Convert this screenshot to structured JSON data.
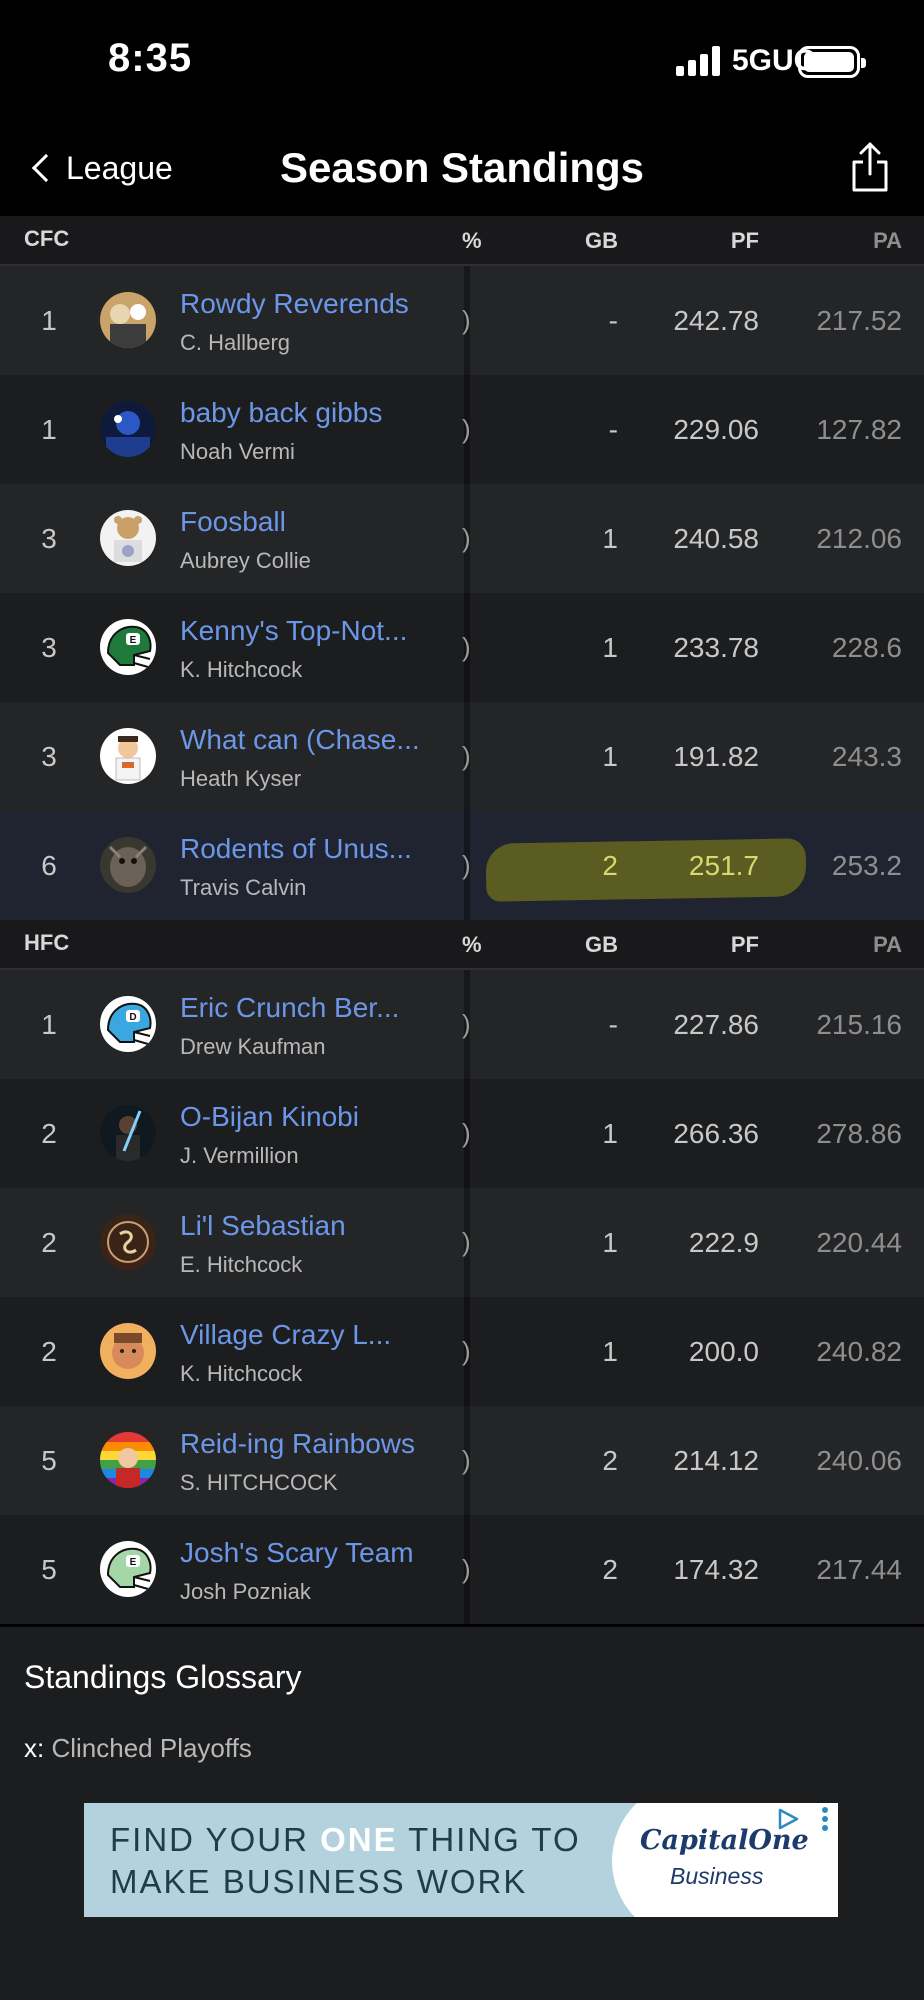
{
  "status_bar": {
    "time": "8:35",
    "network": "5GUC"
  },
  "nav": {
    "back_label": "League",
    "title": "Season Standings"
  },
  "columns": {
    "pct": "%",
    "gb": "GB",
    "pf": "PF",
    "pa": "PA"
  },
  "conferences": [
    {
      "name": "CFC",
      "teams": [
        {
          "rank": "1",
          "name": "Rowdy Reverends",
          "owner": "C. Hallberg",
          "pct": ")",
          "gb": "-",
          "pf": "242.78",
          "pa": "217.52"
        },
        {
          "rank": "1",
          "name": "baby back gibbs",
          "owner": "Noah Vermi",
          "pct": ")",
          "gb": "-",
          "pf": "229.06",
          "pa": "127.82"
        },
        {
          "rank": "3",
          "name": "Foosball",
          "owner": "Aubrey Collie",
          "pct": ")",
          "gb": "1",
          "pf": "240.58",
          "pa": "212.06"
        },
        {
          "rank": "3",
          "name": "Kenny's Top-Not...",
          "owner": "K. Hitchcock",
          "pct": ")",
          "gb": "1",
          "pf": "233.78",
          "pa": "228.6"
        },
        {
          "rank": "3",
          "name": "What can (Chase...",
          "owner": "Heath Kyser",
          "pct": ")",
          "gb": "1",
          "pf": "191.82",
          "pa": "243.3"
        },
        {
          "rank": "6",
          "name": "Rodents of Unus...",
          "owner": "Travis Calvin",
          "pct": ")",
          "gb": "2",
          "pf": "251.7",
          "pa": "253.2"
        }
      ]
    },
    {
      "name": "HFC",
      "teams": [
        {
          "rank": "1",
          "name": "Eric Crunch Ber...",
          "owner": "Drew Kaufman",
          "pct": ")",
          "gb": "-",
          "pf": "227.86",
          "pa": "215.16"
        },
        {
          "rank": "2",
          "name": "O-Bijan Kinobi",
          "owner": "J. Vermillion",
          "pct": ")",
          "gb": "1",
          "pf": "266.36",
          "pa": "278.86"
        },
        {
          "rank": "2",
          "name": "Li'l Sebastian",
          "owner": "E. Hitchcock",
          "pct": ")",
          "gb": "1",
          "pf": "222.9",
          "pa": "220.44"
        },
        {
          "rank": "2",
          "name": "Village Crazy L...",
          "owner": "K. Hitchcock",
          "pct": ")",
          "gb": "1",
          "pf": "200.0",
          "pa": "240.82"
        },
        {
          "rank": "5",
          "name": "Reid-ing Rainbows",
          "owner": "S. HITCHCOCK",
          "pct": ")",
          "gb": "2",
          "pf": "214.12",
          "pa": "240.06"
        },
        {
          "rank": "5",
          "name": "Josh's Scary Team",
          "owner": "Josh Pozniak",
          "pct": ")",
          "gb": "2",
          "pf": "174.32",
          "pa": "217.44"
        }
      ]
    }
  ],
  "glossary": {
    "title": "Standings Glossary",
    "key": "x:",
    "description": " Clinched Playoffs"
  },
  "ad": {
    "line1_pre": "FIND YOUR ",
    "line1_emph": "ONE",
    "line1_post": " THING TO",
    "line2": "MAKE BUSINESS WORK",
    "logo": "CapitalOne",
    "logo_sub": "Business"
  },
  "colors": {
    "link": "#6c97e8",
    "highlight_marker": "#8a8a16",
    "background": "#1c1d1f"
  }
}
